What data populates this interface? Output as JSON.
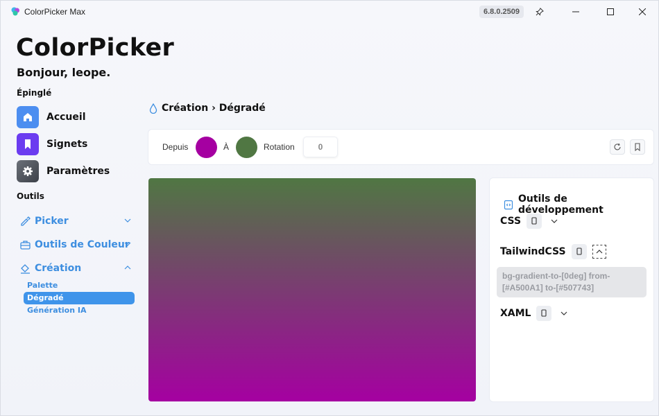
{
  "window": {
    "title": "ColorPicker Max",
    "version": "6.8.0.2509"
  },
  "header": {
    "app_name": "ColorPicker",
    "greeting": "Bonjour, leope."
  },
  "sidebar": {
    "pinned_label": "Épinglé",
    "pinned_items": [
      {
        "label": "Accueil",
        "icon": "home-icon",
        "color": "#4c8ef0"
      },
      {
        "label": "Signets",
        "icon": "bookmark-icon",
        "color": "#6b3cf0"
      },
      {
        "label": "Paramètres",
        "icon": "gear-icon",
        "color": "#555a63"
      }
    ],
    "tools_label": "Outils",
    "tools": [
      {
        "label": "Picker",
        "icon": "eyedropper-icon",
        "expanded": false
      },
      {
        "label": "Outils de Couleur",
        "icon": "toolbox-icon",
        "expanded": false
      },
      {
        "label": "Création",
        "icon": "paint-bucket-icon",
        "expanded": true
      }
    ],
    "creation_subitems": [
      {
        "label": "Palette",
        "active": false
      },
      {
        "label": "Dégradé",
        "active": true
      },
      {
        "label": "Génération IA",
        "active": false
      }
    ]
  },
  "breadcrumb": {
    "text": "Création › Dégradé"
  },
  "toolbar": {
    "from_label": "Depuis",
    "from_color": "#A500A1",
    "to_label": "À",
    "to_color": "#507743",
    "rotation_label": "Rotation",
    "rotation_value": "0"
  },
  "dev_tools": {
    "title": "Outils de développement",
    "css_label": "CSS",
    "tailwind_label": "TailwindCSS",
    "tailwind_code": "bg-gradient-to-[0deg] from-[#A500A1] to-[#507743]",
    "xaml_label": "XAML"
  },
  "colors": {
    "accent": "#3d8ee0",
    "active_bg": "#3f94ea"
  }
}
